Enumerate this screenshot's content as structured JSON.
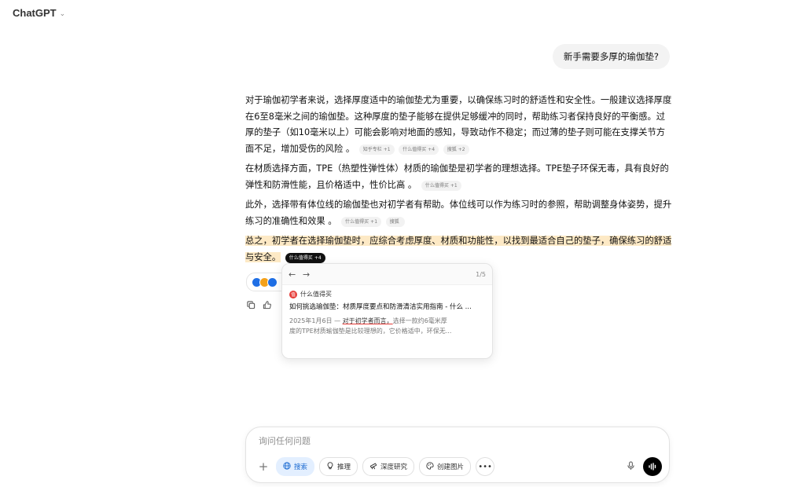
{
  "header": {
    "model_name": "ChatGPT"
  },
  "conversation": {
    "user_message": "新手需要多厚的瑜伽垫?",
    "paragraphs": [
      {
        "text": "对于瑜伽初学者来说，选择厚度适中的瑜伽垫尤为重要，以确保练习时的舒适性和安全性。一般建议选择厚度在6至8毫米之间的瑜伽垫。这种厚度的垫子能够在提供足够缓冲的同时，帮助练习者保持良好的平衡感。过厚的垫子（如10毫米以上）可能会影响对地面的感知，导致动作不稳定；而过薄的垫子则可能在支撑关节方面不足，增加受伤的风险 。",
        "citations": [
          {
            "label": "知乎专栏",
            "count": "+1"
          },
          {
            "label": "什么值得买",
            "count": "+4"
          },
          {
            "label": "搜狐",
            "count": "+2"
          }
        ]
      },
      {
        "text": "在材质选择方面，TPE（热塑性弹性体）材质的瑜伽垫是初学者的理想选择。TPE垫子环保无毒，具有良好的弹性和防滑性能，且价格适中，性价比高 。",
        "citations": [
          {
            "label": "什么值得买",
            "count": "+1"
          }
        ]
      },
      {
        "text": "此外，选择带有体位线的瑜伽垫也对初学者有帮助。体位线可以作为练习时的参照，帮助调整身体姿势，提升练习的准确性和效果 。",
        "citations": [
          {
            "label": "什么值得买",
            "count": "+1"
          },
          {
            "label": "搜狐",
            "count": ""
          }
        ]
      },
      {
        "text": "总之，初学者在选择瑜伽垫时，应综合考虑厚度、材质和功能性，以找到最适合自己的垫子，确保练习的舒适与安全。",
        "citations": [
          {
            "label": "什么值得买",
            "count": "+4"
          }
        ]
      }
    ]
  },
  "citation_popover": {
    "page": "1/5",
    "site_name": "什么值得买",
    "site_logo_letter": "值",
    "title": "如何挑选瑜伽垫：材质厚度要点和防滑清洁实用指南 - 什么 ...",
    "date": "2025年1月6日 — ",
    "snippet_highlight": "对于初学者而言，",
    "snippet_rest": "选择一款约6毫米厚",
    "snippet_line2": "度的TPE材质瑜伽垫是比较理想的，它价格适中，环保无..."
  },
  "composer": {
    "placeholder": "询问任何问题",
    "tools": [
      {
        "label": "搜索",
        "icon": "globe-icon",
        "active": true
      },
      {
        "label": "推理",
        "icon": "lightbulb-icon",
        "active": false
      },
      {
        "label": "深度研究",
        "icon": "telescope-icon",
        "active": false
      },
      {
        "label": "创建图片",
        "icon": "palette-icon",
        "active": false
      }
    ]
  },
  "colors": {
    "highlight": "#fde9c5",
    "search_active_bg": "#e3efff",
    "search_active_text": "#1a6ad1",
    "user_bubble_bg": "#f3f3f3"
  }
}
